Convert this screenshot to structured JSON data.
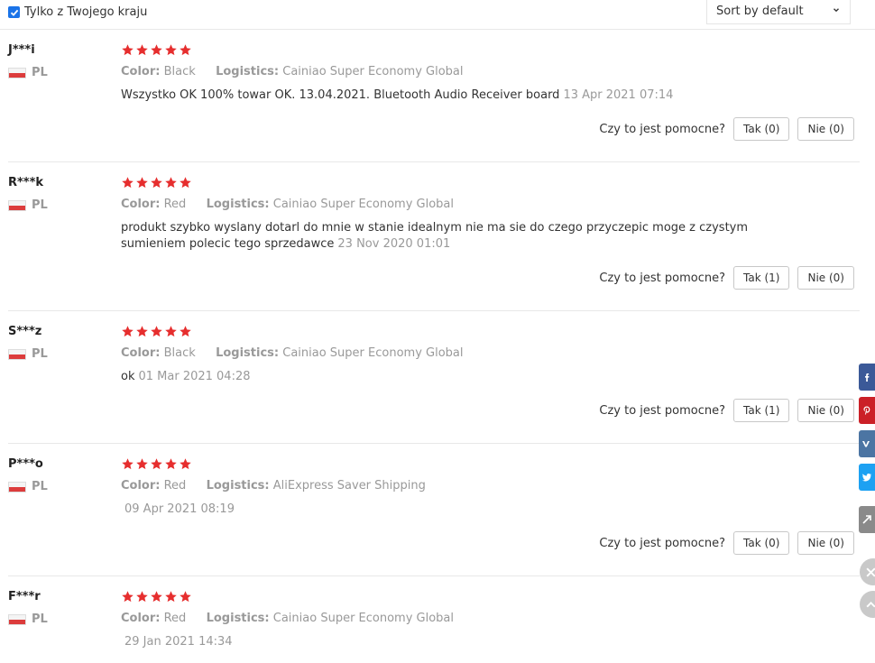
{
  "filter": {
    "label": "Tylko z Twojego kraju",
    "checked": true
  },
  "sort": {
    "value": "Sort by default"
  },
  "labels": {
    "color": "Color:",
    "logistics": "Logistics:",
    "helpful": "Czy to jest pomocne?"
  },
  "reviews": [
    {
      "user": "J***i",
      "country": "PL",
      "rating": 5,
      "color": "Black",
      "logistics": "Cainiao Super Economy Global",
      "text": "Wszystko OK 100% towar OK. 13.04.2021. Bluetooth Audio Receiver board",
      "date": "13 Apr 2021 07:14",
      "yes": "Tak (0)",
      "no": "Nie (0)"
    },
    {
      "user": "R***k",
      "country": "PL",
      "rating": 5,
      "color": "Red",
      "logistics": "Cainiao Super Economy Global",
      "text": "produkt szybko wyslany dotarl do mnie w stanie idealnym nie ma sie do czego przyczepic moge z czystym sumieniem polecic tego sprzedawce",
      "date": "23 Nov 2020 01:01",
      "yes": "Tak (1)",
      "no": "Nie (0)"
    },
    {
      "user": "S***z",
      "country": "PL",
      "rating": 5,
      "color": "Black",
      "logistics": "Cainiao Super Economy Global",
      "text": "ok",
      "date": "01 Mar 2021 04:28",
      "yes": "Tak (1)",
      "no": "Nie (0)"
    },
    {
      "user": "P***o",
      "country": "PL",
      "rating": 5,
      "color": "Red",
      "logistics": "AliExpress Saver Shipping",
      "text": "",
      "date": "09 Apr 2021 08:19",
      "yes": "Tak (0)",
      "no": "Nie (0)"
    },
    {
      "user": "F***r",
      "country": "PL",
      "rating": 5,
      "color": "Red",
      "logistics": "Cainiao Super Economy Global",
      "text": "",
      "date": "29 Jan 2021 14:34",
      "yes": "",
      "no": ""
    }
  ],
  "colors": {
    "star": "#e62e2e",
    "checkbox": "#1a73e8",
    "facebook": "#3b5998",
    "pinterest": "#cb2027",
    "vk": "#4c75a3",
    "twitter": "#1da1f2",
    "email": "#8a8a8a"
  },
  "share_icons": [
    "facebook-icon",
    "pinterest-icon",
    "vk-icon",
    "twitter-icon",
    "email-icon"
  ]
}
